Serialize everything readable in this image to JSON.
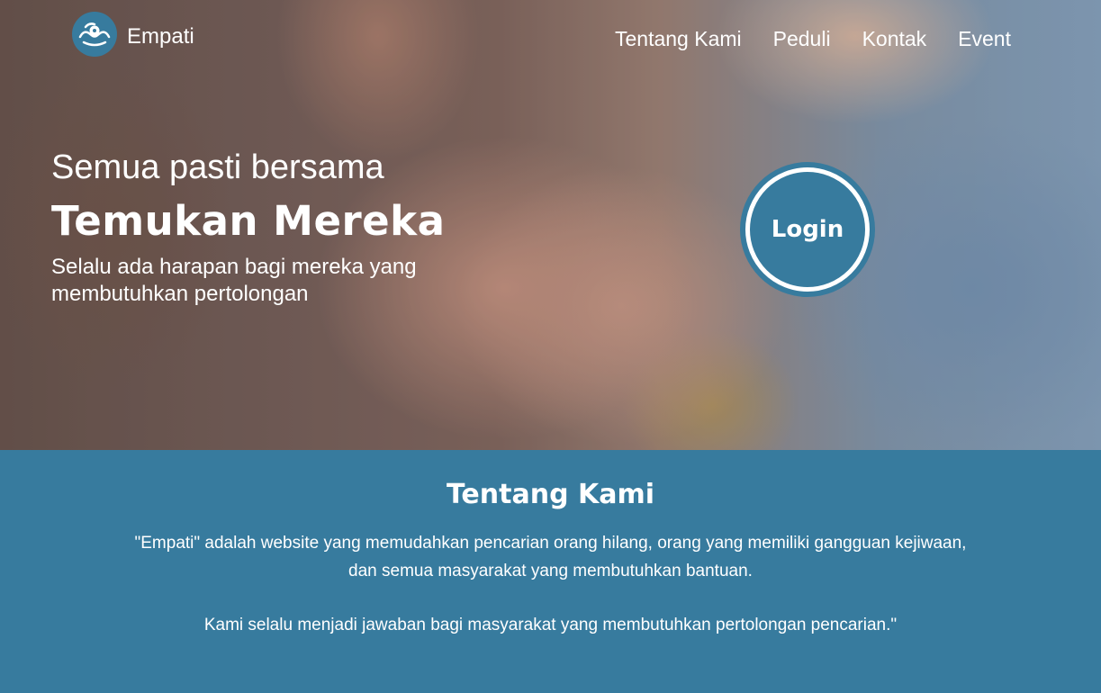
{
  "brand": {
    "name": "Empati",
    "logo_icon": "hands-heart-gear-icon"
  },
  "nav": {
    "items": [
      {
        "label": "Tentang Kami"
      },
      {
        "label": "Peduli"
      },
      {
        "label": "Kontak"
      },
      {
        "label": "Event"
      }
    ]
  },
  "hero": {
    "kicker": "Semua pasti bersama",
    "title": "Temukan Mereka",
    "subtitle": "Selalu ada harapan bagi mereka yang membutuhkan pertolongan",
    "login_label": "Login"
  },
  "about": {
    "title": "Tentang Kami",
    "line1": "\"Empati\" adalah website yang memudahkan pencarian orang hilang, orang yang memiliki gangguan kejiwaan,",
    "line2": "dan semua masyarakat yang membutuhkan bantuan.",
    "line3": "Kami selalu menjadi jawaban bagi masyarakat yang membutuhkan pertolongan pencarian.\""
  },
  "colors": {
    "primary": "#377b9e",
    "text_light": "#ffffff"
  }
}
